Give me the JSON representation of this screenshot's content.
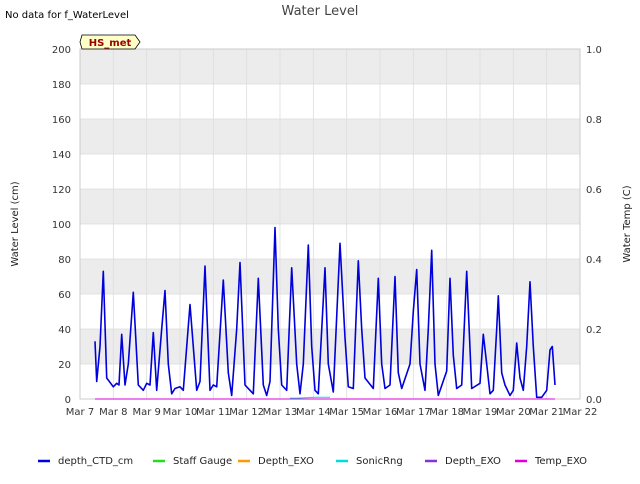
{
  "no_data_note": "No data for f_WaterLevel",
  "chart_data": {
    "type": "line",
    "title": "Water Level",
    "ylabel": "Water Level (cm)",
    "y2label": "Water Temp (C)",
    "ylim": [
      0,
      200
    ],
    "y2lim": [
      0,
      1.0
    ],
    "yticks": [
      "0",
      "20",
      "40",
      "60",
      "80",
      "100",
      "120",
      "140",
      "160",
      "180",
      "200"
    ],
    "y2ticks": [
      "0.0",
      "0.2",
      "0.4",
      "0.6",
      "0.8",
      "1.0"
    ],
    "xticks": [
      "Mar 7",
      "Mar 8",
      "Mar 9",
      "Mar 10",
      "Mar 11",
      "Mar 12",
      "Mar 13",
      "Mar 14",
      "Mar 15",
      "Mar 16",
      "Mar 17",
      "Mar 18",
      "Mar 19",
      "Mar 20",
      "Mar 21",
      "Mar 22"
    ],
    "xlim_days": [
      7,
      22
    ],
    "x_unit": "day of March",
    "grid": true,
    "band_shading": true,
    "annotation_box": "HS_met",
    "legend_position": "bottom",
    "series": [
      {
        "name": "depth_CTD_cm",
        "color": "#0000dd",
        "points": [
          [
            7.45,
            33
          ],
          [
            7.5,
            10
          ],
          [
            7.6,
            30
          ],
          [
            7.7,
            73
          ],
          [
            7.8,
            12
          ],
          [
            8.0,
            7
          ],
          [
            8.1,
            9
          ],
          [
            8.17,
            8
          ],
          [
            8.25,
            37
          ],
          [
            8.35,
            8
          ],
          [
            8.45,
            20
          ],
          [
            8.6,
            61
          ],
          [
            8.75,
            8
          ],
          [
            8.9,
            5
          ],
          [
            9.0,
            9
          ],
          [
            9.1,
            8
          ],
          [
            9.2,
            38
          ],
          [
            9.3,
            5
          ],
          [
            9.45,
            40
          ],
          [
            9.55,
            62
          ],
          [
            9.65,
            20
          ],
          [
            9.75,
            3
          ],
          [
            9.85,
            6
          ],
          [
            10.0,
            7
          ],
          [
            10.1,
            5
          ],
          [
            10.3,
            54
          ],
          [
            10.5,
            5
          ],
          [
            10.6,
            10
          ],
          [
            10.75,
            76
          ],
          [
            10.9,
            5
          ],
          [
            11.0,
            8
          ],
          [
            11.1,
            7
          ],
          [
            11.3,
            68
          ],
          [
            11.45,
            15
          ],
          [
            11.55,
            2
          ],
          [
            11.7,
            40
          ],
          [
            11.8,
            78
          ],
          [
            11.95,
            8
          ],
          [
            12.1,
            5
          ],
          [
            12.2,
            3
          ],
          [
            12.35,
            69
          ],
          [
            12.5,
            8
          ],
          [
            12.6,
            2
          ],
          [
            12.7,
            10
          ],
          [
            12.85,
            98
          ],
          [
            12.95,
            40
          ],
          [
            13.05,
            8
          ],
          [
            13.2,
            5
          ],
          [
            13.35,
            75
          ],
          [
            13.5,
            20
          ],
          [
            13.6,
            3
          ],
          [
            13.7,
            20
          ],
          [
            13.85,
            88
          ],
          [
            13.95,
            30
          ],
          [
            14.05,
            5
          ],
          [
            14.15,
            3
          ],
          [
            14.35,
            75
          ],
          [
            14.45,
            20
          ],
          [
            14.6,
            4
          ],
          [
            14.8,
            89
          ],
          [
            14.95,
            35
          ],
          [
            15.05,
            7
          ],
          [
            15.2,
            6
          ],
          [
            15.35,
            79
          ],
          [
            15.45,
            40
          ],
          [
            15.55,
            12
          ],
          [
            15.8,
            6
          ],
          [
            15.95,
            69
          ],
          [
            16.05,
            20
          ],
          [
            16.15,
            6
          ],
          [
            16.3,
            8
          ],
          [
            16.45,
            70
          ],
          [
            16.55,
            15
          ],
          [
            16.65,
            6
          ],
          [
            16.9,
            20
          ],
          [
            17.0,
            50
          ],
          [
            17.1,
            74
          ],
          [
            17.2,
            20
          ],
          [
            17.35,
            5
          ],
          [
            17.45,
            40
          ],
          [
            17.55,
            85
          ],
          [
            17.65,
            20
          ],
          [
            17.75,
            2
          ],
          [
            18.0,
            16
          ],
          [
            18.1,
            69
          ],
          [
            18.2,
            25
          ],
          [
            18.3,
            6
          ],
          [
            18.45,
            8
          ],
          [
            18.6,
            73
          ],
          [
            18.75,
            6
          ],
          [
            19.0,
            9
          ],
          [
            19.1,
            37
          ],
          [
            19.2,
            20
          ],
          [
            19.3,
            3
          ],
          [
            19.4,
            5
          ],
          [
            19.5,
            40
          ],
          [
            19.55,
            59
          ],
          [
            19.65,
            15
          ],
          [
            19.75,
            8
          ],
          [
            19.9,
            2
          ],
          [
            20.0,
            5
          ],
          [
            20.1,
            32
          ],
          [
            20.2,
            12
          ],
          [
            20.3,
            5
          ],
          [
            20.4,
            30
          ],
          [
            20.5,
            67
          ],
          [
            20.6,
            30
          ],
          [
            20.7,
            1
          ],
          [
            20.85,
            1
          ],
          [
            21.0,
            5
          ],
          [
            21.1,
            28
          ],
          [
            21.17,
            30
          ],
          [
            21.25,
            8
          ]
        ]
      },
      {
        "name": "Staff Gauge",
        "color": "#22dd22",
        "points": []
      },
      {
        "name": "Depth_EXO",
        "color": "#ff9900",
        "points": []
      },
      {
        "name": "SonicRng",
        "color": "#00dddd",
        "points": [
          [
            13.3,
            0.5
          ],
          [
            13.5,
            0.5
          ],
          [
            14.05,
            1
          ],
          [
            14.5,
            1
          ]
        ]
      },
      {
        "name": "Depth_EXO",
        "color": "#8833cc",
        "points": [
          [
            7.45,
            0
          ],
          [
            21.25,
            0
          ]
        ]
      },
      {
        "name": "Temp_EXO",
        "color": "#dd00dd",
        "points": [
          [
            7.45,
            0
          ],
          [
            21.25,
            0
          ]
        ]
      }
    ]
  }
}
